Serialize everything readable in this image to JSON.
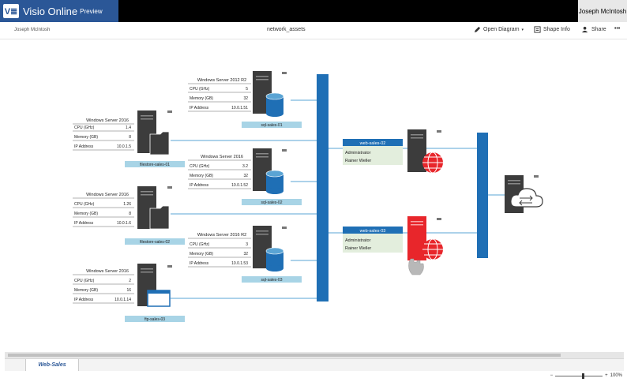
{
  "app": {
    "logo": "V≣",
    "name": "Visio Online",
    "edition": "Preview",
    "user": "Joseph McIntosh"
  },
  "command_bar": {
    "owner": "Joseph McIntosh",
    "document_title": "network_assets",
    "open_diagram": "Open Diagram",
    "shape_info": "Shape Info",
    "share": "Share",
    "more": "•••"
  },
  "sheet_tabs": [
    "Web-Sales"
  ],
  "zoom": {
    "minus": "−",
    "plus": "+",
    "level": "100%"
  },
  "servers": {
    "fs01": {
      "title": "Windows Server 2016",
      "cpu": "1.4",
      "memory": "8",
      "ip": "10.0.1.5",
      "label": "filestore-sales-01"
    },
    "fs02": {
      "title": "Windows Server 2016",
      "cpu": "1.26",
      "memory": "8",
      "ip": "10.0.1.6",
      "label": "filestore-sales-02"
    },
    "ftp03": {
      "title": "Windows Server 2016",
      "cpu": "2",
      "memory": "16",
      "ip": "10.0.1.14",
      "label": "ftp-sales-03"
    },
    "sql01": {
      "title": "Windows Server 2012 R2",
      "cpu": "5",
      "memory": "32",
      "ip": "10.0.1.51",
      "label": "sql-sales-01"
    },
    "sql02": {
      "title": "Windows Server 2016",
      "cpu": "3.2",
      "memory": "32",
      "ip": "10.0.1.52",
      "label": "sql-sales-02"
    },
    "sql03": {
      "title": "Windows Server 2016 R2",
      "cpu": "3",
      "memory": "32",
      "ip": "10.0.1.53",
      "label": "sql-sales-03"
    }
  },
  "row_labels": {
    "cpu": "CPU (GHz)",
    "memory": "Memory (GB)",
    "ip": "IP Address"
  },
  "web": {
    "w02": {
      "title": "web-sales-02",
      "line1": "Administrator",
      "line2": "Rainer Weller"
    },
    "w03": {
      "title": "web-sales-03",
      "line1": "Administrator",
      "line2": "Rainer Weller"
    }
  },
  "colors": {
    "brand": "#2b5797",
    "bus": "#1f6fb5",
    "label_bg": "#a8d4e6",
    "web_header": "#1f6fb5",
    "web_body": "#e3eedd",
    "alert": "#e8262b",
    "server": "#3c3c3c"
  }
}
